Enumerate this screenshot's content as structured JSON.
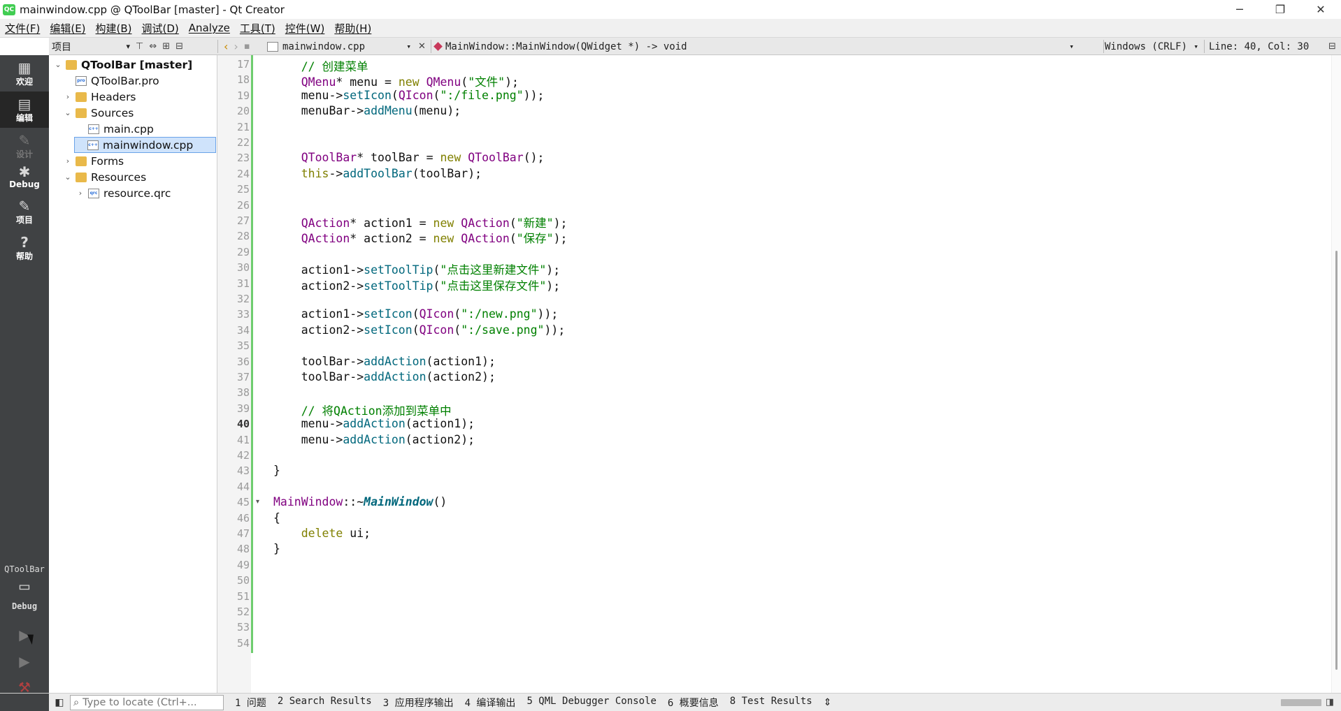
{
  "window": {
    "title": "mainwindow.cpp @ QToolBar [master] - Qt Creator",
    "app_icon": "QC",
    "minimize": "─",
    "restore": "❐",
    "close": "✕"
  },
  "menubar": [
    "文件(F)",
    "编辑(E)",
    "构建(B)",
    "调试(D)",
    "Analyze",
    "工具(T)",
    "控件(W)",
    "帮助(H)"
  ],
  "toolbar": {
    "project_combo": "项目",
    "project_combo_arrow": "▾",
    "filter_icon": "⊤",
    "link_icon": "⇔",
    "split_icon": "⊞",
    "close_pane_icon": "⊟",
    "back_icon": "‹",
    "forward_icon": "›",
    "lock_icon": "▪",
    "file_combo": "mainwindow.cpp",
    "file_combo_arrow": "▾",
    "close_file": "✕",
    "symbol_combo": "MainWindow::MainWindow(QWidget *) -> void",
    "symbol_arrow": "▾",
    "encoding": "Windows (CRLF)",
    "encoding_arrow": "▾",
    "position": "Line: 40, Col: 30",
    "split_editor_icon": "⊟"
  },
  "modes": [
    {
      "label": "欢迎",
      "icon": "grid-icon",
      "glyph": "▦"
    },
    {
      "label": "编辑",
      "icon": "edit-icon",
      "glyph": "▤"
    },
    {
      "label": "设计",
      "icon": "design-icon",
      "glyph": "✎"
    },
    {
      "label": "Debug",
      "icon": "bug-icon",
      "glyph": "✱"
    },
    {
      "label": "项目",
      "icon": "wrench-icon",
      "glyph": "✎"
    },
    {
      "label": "帮助",
      "icon": "help-icon",
      "glyph": "?"
    }
  ],
  "kit": {
    "project": "QToolBar",
    "config": "Debug",
    "glyph": "▭"
  },
  "run_buttons": {
    "run": "▶",
    "debug_run": "▶",
    "build": "⚒"
  },
  "project_tree": [
    {
      "label": "QToolBar [master]",
      "arrow": "⌄",
      "type": "folder",
      "bold": true
    },
    {
      "label": "QToolBar.pro",
      "arrow": "",
      "type": "file",
      "icon_text": "pro"
    },
    {
      "label": "Headers",
      "arrow": "›",
      "type": "folder"
    },
    {
      "label": "Sources",
      "arrow": "⌄",
      "type": "folder"
    },
    {
      "label": "main.cpp",
      "arrow": "",
      "type": "file",
      "icon_text": "c++"
    },
    {
      "label": "mainwindow.cpp",
      "arrow": "",
      "type": "file",
      "icon_text": "c++",
      "selected": true
    },
    {
      "label": "Forms",
      "arrow": "›",
      "type": "folder"
    },
    {
      "label": "Resources",
      "arrow": "⌄",
      "type": "folder"
    },
    {
      "label": "resource.qrc",
      "arrow": "›",
      "type": "file",
      "icon_text": "qrc"
    }
  ],
  "editor": {
    "current_line": 40,
    "fold_marker": "▾",
    "lines": [
      {
        "n": "17",
        "code": [
          {
            "t": "    "
          },
          {
            "t": "// 创建菜单",
            "c": "green"
          }
        ]
      },
      {
        "n": "18",
        "code": [
          {
            "t": "    "
          },
          {
            "t": "QMenu",
            "c": "purple"
          },
          {
            "t": "* menu = "
          },
          {
            "t": "new",
            "c": "olive"
          },
          {
            "t": " "
          },
          {
            "t": "QMenu",
            "c": "purple"
          },
          {
            "t": "("
          },
          {
            "t": "\"文件\"",
            "c": "green"
          },
          {
            "t": ");"
          }
        ]
      },
      {
        "n": "19",
        "code": [
          {
            "t": "    menu->"
          },
          {
            "t": "setIcon",
            "c": "teal"
          },
          {
            "t": "("
          },
          {
            "t": "QIcon",
            "c": "purple"
          },
          {
            "t": "("
          },
          {
            "t": "\":/file.png\"",
            "c": "green"
          },
          {
            "t": "));"
          }
        ]
      },
      {
        "n": "20",
        "code": [
          {
            "t": "    menuBar->"
          },
          {
            "t": "addMenu",
            "c": "teal"
          },
          {
            "t": "(menu);"
          }
        ]
      },
      {
        "n": "21",
        "code": []
      },
      {
        "n": "22",
        "code": []
      },
      {
        "n": "23",
        "code": [
          {
            "t": "    "
          },
          {
            "t": "QToolBar",
            "c": "purple"
          },
          {
            "t": "* toolBar = "
          },
          {
            "t": "new",
            "c": "olive"
          },
          {
            "t": " "
          },
          {
            "t": "QToolBar",
            "c": "purple"
          },
          {
            "t": "();"
          }
        ]
      },
      {
        "n": "24",
        "code": [
          {
            "t": "    "
          },
          {
            "t": "this",
            "c": "olive"
          },
          {
            "t": "->"
          },
          {
            "t": "addToolBar",
            "c": "teal"
          },
          {
            "t": "(toolBar);"
          }
        ]
      },
      {
        "n": "25",
        "code": []
      },
      {
        "n": "26",
        "code": []
      },
      {
        "n": "27",
        "code": [
          {
            "t": "    "
          },
          {
            "t": "QAction",
            "c": "purple"
          },
          {
            "t": "* action1 = "
          },
          {
            "t": "new",
            "c": "olive"
          },
          {
            "t": " "
          },
          {
            "t": "QAction",
            "c": "purple"
          },
          {
            "t": "("
          },
          {
            "t": "\"新建\"",
            "c": "green"
          },
          {
            "t": ");"
          }
        ]
      },
      {
        "n": "28",
        "code": [
          {
            "t": "    "
          },
          {
            "t": "QAction",
            "c": "purple"
          },
          {
            "t": "* action2 = "
          },
          {
            "t": "new",
            "c": "olive"
          },
          {
            "t": " "
          },
          {
            "t": "QAction",
            "c": "purple"
          },
          {
            "t": "("
          },
          {
            "t": "\"保存\"",
            "c": "green"
          },
          {
            "t": ");"
          }
        ]
      },
      {
        "n": "29",
        "code": []
      },
      {
        "n": "30",
        "code": [
          {
            "t": "    action1->"
          },
          {
            "t": "setToolTip",
            "c": "teal"
          },
          {
            "t": "("
          },
          {
            "t": "\"点击这里新建文件\"",
            "c": "green"
          },
          {
            "t": ");"
          }
        ]
      },
      {
        "n": "31",
        "code": [
          {
            "t": "    action2->"
          },
          {
            "t": "setToolTip",
            "c": "teal"
          },
          {
            "t": "("
          },
          {
            "t": "\"点击这里保存文件\"",
            "c": "green"
          },
          {
            "t": ");"
          }
        ]
      },
      {
        "n": "32",
        "code": []
      },
      {
        "n": "33",
        "code": [
          {
            "t": "    action1->"
          },
          {
            "t": "setIcon",
            "c": "teal"
          },
          {
            "t": "("
          },
          {
            "t": "QIcon",
            "c": "purple"
          },
          {
            "t": "("
          },
          {
            "t": "\":/new.png\"",
            "c": "green"
          },
          {
            "t": "));"
          }
        ]
      },
      {
        "n": "34",
        "code": [
          {
            "t": "    action2->"
          },
          {
            "t": "setIcon",
            "c": "teal"
          },
          {
            "t": "("
          },
          {
            "t": "QIcon",
            "c": "purple"
          },
          {
            "t": "("
          },
          {
            "t": "\":/save.png\"",
            "c": "green"
          },
          {
            "t": "));"
          }
        ]
      },
      {
        "n": "35",
        "code": []
      },
      {
        "n": "36",
        "code": [
          {
            "t": "    toolBar->"
          },
          {
            "t": "addAction",
            "c": "teal"
          },
          {
            "t": "(action1);"
          }
        ]
      },
      {
        "n": "37",
        "code": [
          {
            "t": "    toolBar->"
          },
          {
            "t": "addAction",
            "c": "teal"
          },
          {
            "t": "(action2);"
          }
        ]
      },
      {
        "n": "38",
        "code": []
      },
      {
        "n": "39",
        "code": [
          {
            "t": "    "
          },
          {
            "t": "// 将QAction添加到菜单中",
            "c": "green"
          }
        ]
      },
      {
        "n": "40",
        "code": [
          {
            "t": "    menu->"
          },
          {
            "t": "addAction",
            "c": "teal"
          },
          {
            "t": "(action1);"
          }
        ]
      },
      {
        "n": "41",
        "code": [
          {
            "t": "    menu->"
          },
          {
            "t": "addAction",
            "c": "teal"
          },
          {
            "t": "(action2);"
          }
        ]
      },
      {
        "n": "42",
        "code": []
      },
      {
        "n": "43",
        "code": [
          {
            "t": "}"
          }
        ]
      },
      {
        "n": "44",
        "code": []
      },
      {
        "n": "45",
        "code": [
          {
            "t": "MainWindow",
            "c": "purple"
          },
          {
            "t": "::~"
          },
          {
            "t": "MainWindow",
            "c": "func"
          },
          {
            "t": "()"
          }
        ],
        "fold": true
      },
      {
        "n": "46",
        "code": [
          {
            "t": "{"
          }
        ]
      },
      {
        "n": "47",
        "code": [
          {
            "t": "    "
          },
          {
            "t": "delete",
            "c": "olive"
          },
          {
            "t": " ui;"
          }
        ]
      },
      {
        "n": "48",
        "code": [
          {
            "t": "}"
          }
        ]
      },
      {
        "n": "49",
        "code": []
      },
      {
        "n": "50",
        "code": []
      },
      {
        "n": "51",
        "code": []
      },
      {
        "n": "52",
        "code": []
      },
      {
        "n": "53",
        "code": []
      },
      {
        "n": "54",
        "code": []
      }
    ]
  },
  "statusbar": {
    "toggle_sidebar": "◧",
    "locator_icon": "⌕",
    "locator_placeholder": "Type to locate (Ctrl+...",
    "panes": [
      "1 问题",
      "2 Search Results",
      "3 应用程序输出",
      "4 编译输出",
      "5 QML Debugger Console",
      "6 概要信息",
      "8 Test Results"
    ],
    "more_panes": "⇕",
    "toggle_output": "◨"
  }
}
